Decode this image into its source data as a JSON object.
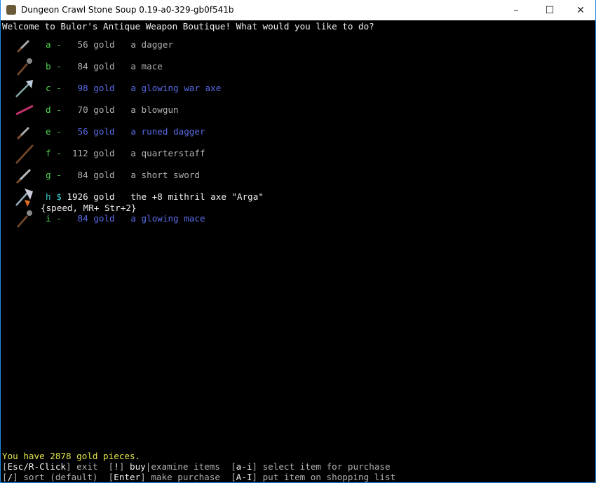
{
  "window": {
    "title": "Dungeon Crawl Stone Soup 0.19-a0-329-gb0f541b",
    "minimize": "–",
    "maximize": "☐",
    "close": "✕"
  },
  "prompt": "Welcome to Bulor's Antique Weapon Boutique! What would you like to do?",
  "items": [
    {
      "letter": "a",
      "sep": "-",
      "price": "  56 gold",
      "name": "a dagger",
      "color": "gray",
      "icon": "dagger-icon"
    },
    {
      "letter": "b",
      "sep": "-",
      "price": "  84 gold",
      "name": "a mace",
      "color": "gray",
      "icon": "mace-icon"
    },
    {
      "letter": "c",
      "sep": "-",
      "price": "  98 gold",
      "name": "a glowing war axe",
      "color": "blue",
      "icon": "war-axe-icon"
    },
    {
      "letter": "d",
      "sep": "-",
      "price": "  70 gold",
      "name": "a blowgun",
      "color": "gray",
      "icon": "blowgun-icon"
    },
    {
      "letter": "e",
      "sep": "-",
      "price": "  56 gold",
      "name": "a runed dagger",
      "color": "blue",
      "icon": "dagger-icon"
    },
    {
      "letter": "f",
      "sep": "-",
      "price": " 112 gold",
      "name": "a quarterstaff",
      "color": "gray",
      "icon": "quarterstaff-icon"
    },
    {
      "letter": "g",
      "sep": "-",
      "price": "  84 gold",
      "name": "a short sword",
      "color": "gray",
      "icon": "short-sword-icon"
    },
    {
      "letter": "h",
      "sep": "$",
      "price": "1926 gold",
      "name": "the +8 mithril axe \"Arga\"",
      "extra": "{speed, MR+ Str+2}",
      "color": "white",
      "icon": "artefact-axe-icon"
    },
    {
      "letter": "i",
      "sep": "-",
      "price": "  84 gold",
      "name": "a glowing mace",
      "color": "blue",
      "icon": "mace-icon"
    }
  ],
  "gold_status": "You have 2878 gold pieces.",
  "help": {
    "line1": [
      {
        "k": "[",
        "c": "gr"
      },
      {
        "k": "Esc/R-Click",
        "c": "w"
      },
      {
        "k": "] exit  [",
        "c": "gr"
      },
      {
        "k": "!",
        "c": "w"
      },
      {
        "k": "] ",
        "c": "gr"
      },
      {
        "k": "buy",
        "c": "w"
      },
      {
        "k": "|examine items  [",
        "c": "gr"
      },
      {
        "k": "a-i",
        "c": "w"
      },
      {
        "k": "] select item for purchase",
        "c": "gr"
      }
    ],
    "line2": [
      {
        "k": "[",
        "c": "gr"
      },
      {
        "k": "/",
        "c": "w"
      },
      {
        "k": "] sort (default)  [",
        "c": "gr"
      },
      {
        "k": "Enter",
        "c": "w"
      },
      {
        "k": "] make purchase  [",
        "c": "gr"
      },
      {
        "k": "A-I",
        "c": "w"
      },
      {
        "k": "] put item on shopping list",
        "c": "gr"
      }
    ]
  },
  "colors": {
    "letter": "#4fd24f",
    "price": "#b0b0b0",
    "glowing": "#5a6be6",
    "artefact": "#f0f0f0",
    "gold_status": "#e6e64a"
  }
}
